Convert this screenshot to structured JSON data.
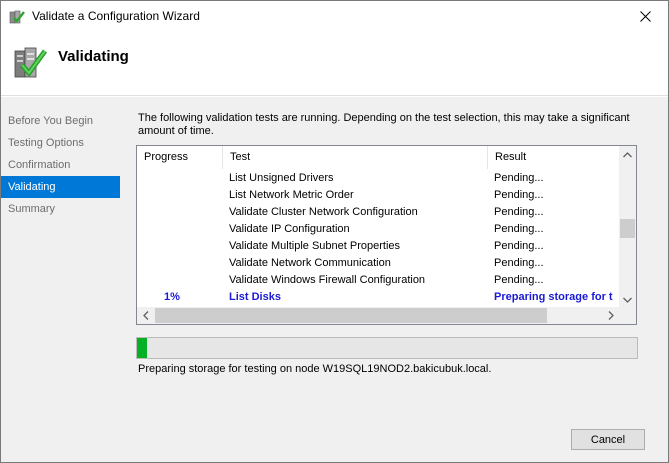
{
  "window": {
    "title": "Validate a Configuration Wizard"
  },
  "header": {
    "heading": "Validating"
  },
  "sidebar": {
    "items": [
      {
        "label": "Before You Begin",
        "active": false
      },
      {
        "label": "Testing Options",
        "active": false
      },
      {
        "label": "Confirmation",
        "active": false
      },
      {
        "label": "Validating",
        "active": true
      },
      {
        "label": "Summary",
        "active": false
      }
    ]
  },
  "main": {
    "intro": "The following validation tests are running. Depending on the test selection, this may take a significant amount of time.",
    "columns": {
      "progress": "Progress",
      "test": "Test",
      "result": "Result"
    },
    "rows": [
      {
        "progress": "",
        "test": "List Unsigned Drivers",
        "result": "Pending..."
      },
      {
        "progress": "",
        "test": "List Network Metric Order",
        "result": "Pending..."
      },
      {
        "progress": "",
        "test": "Validate Cluster Network Configuration",
        "result": "Pending..."
      },
      {
        "progress": "",
        "test": "Validate IP Configuration",
        "result": "Pending..."
      },
      {
        "progress": "",
        "test": "Validate Multiple Subnet Properties",
        "result": "Pending..."
      },
      {
        "progress": "",
        "test": "Validate Network Communication",
        "result": "Pending..."
      },
      {
        "progress": "",
        "test": "Validate Windows Firewall Configuration",
        "result": "Pending..."
      },
      {
        "progress": "1%",
        "test": "List Disks",
        "result": "Preparing storage for t",
        "running": true
      }
    ],
    "progress_value": 0.02,
    "status": "Preparing storage for testing on node W19SQL19NOD2.bakicubuk.local."
  },
  "buttons": {
    "cancel": "Cancel"
  },
  "colors": {
    "accent": "#0078d7",
    "progress_fill": "#06b025",
    "running_text": "#1a1ad6"
  }
}
